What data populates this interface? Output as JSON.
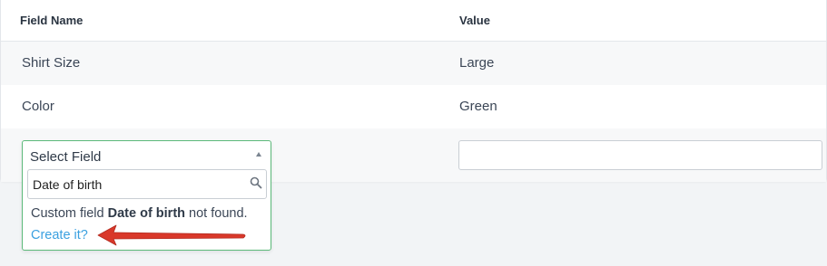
{
  "table": {
    "headers": {
      "field_name": "Field Name",
      "value": "Value"
    },
    "rows": [
      {
        "field": "Shirt Size",
        "value": "Large"
      },
      {
        "field": "Color",
        "value": "Green"
      }
    ]
  },
  "new_row": {
    "value_input": ""
  },
  "select_field": {
    "label": "Select Field",
    "search_value": "Date of birth",
    "not_found_prefix": "Custom field ",
    "not_found_term": "Date of birth",
    "not_found_suffix": " not found.",
    "create_link": "Create it?"
  },
  "colors": {
    "accent_green": "#5cb97a",
    "link_blue": "#3aa0e0",
    "annotation_red": "#d9382a"
  },
  "icons": {
    "search": "search-icon",
    "caret": "caret-up-icon",
    "annotation": "red-arrow"
  }
}
